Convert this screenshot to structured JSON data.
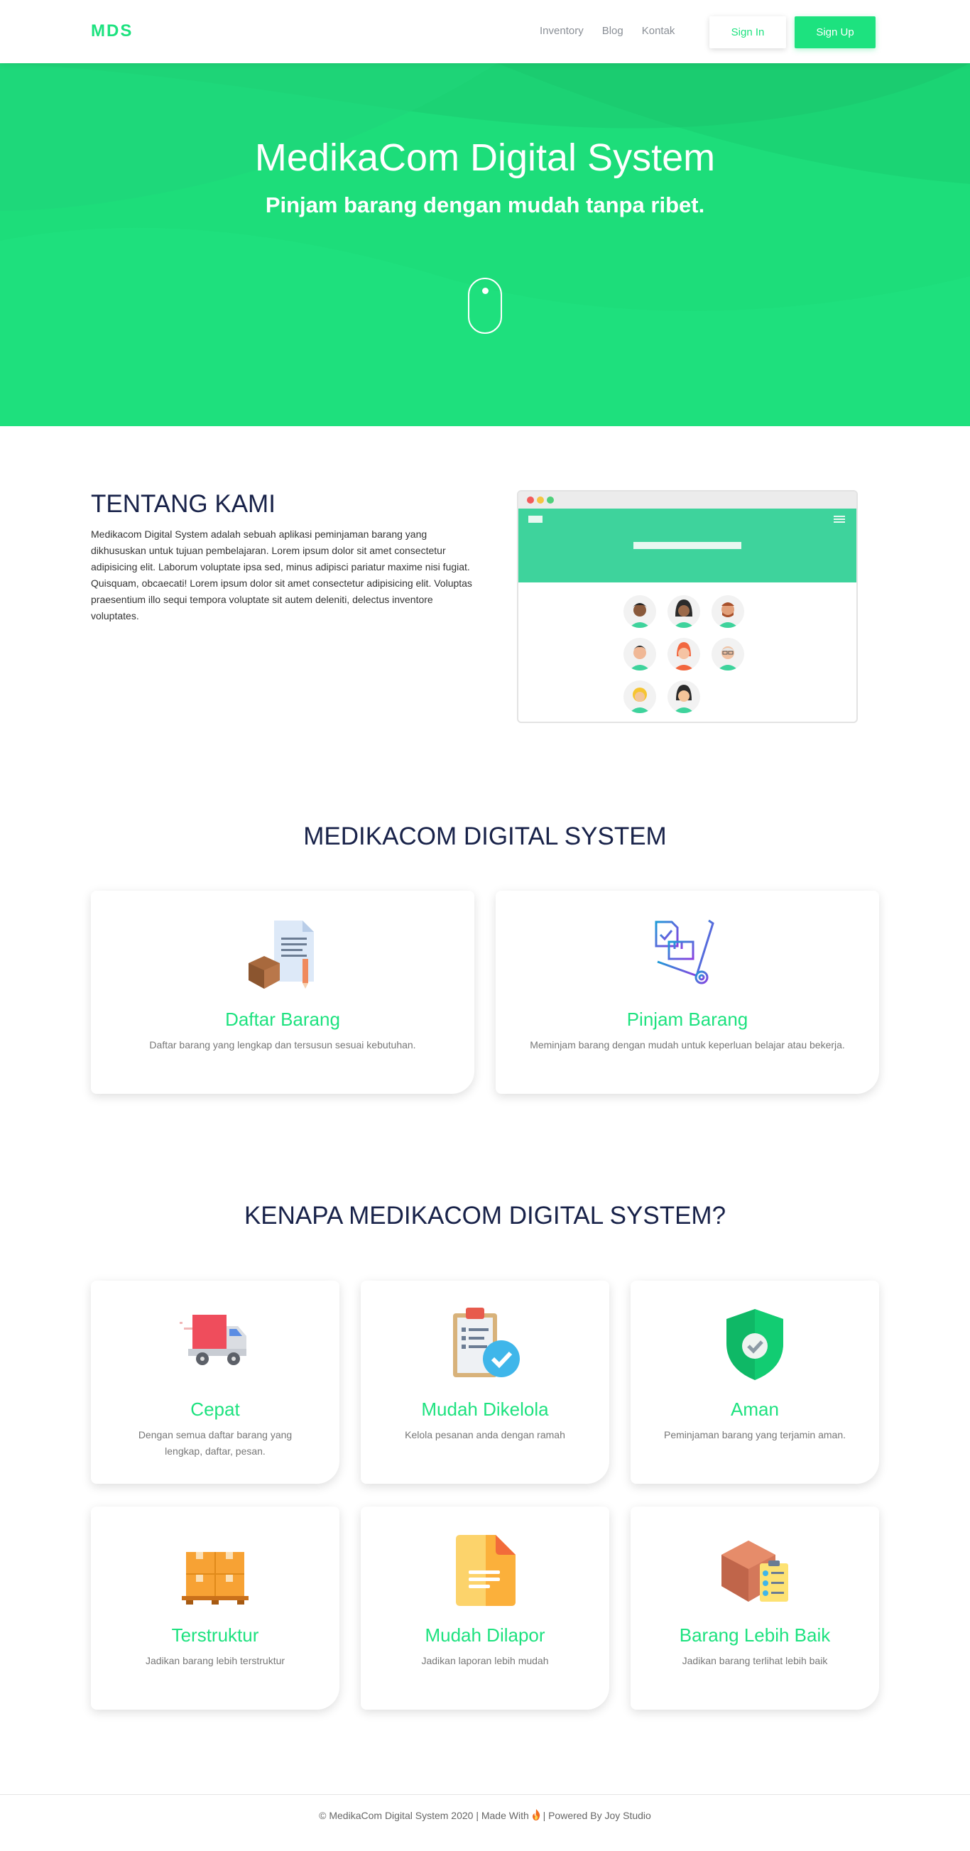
{
  "nav": {
    "brand": "MDS",
    "links": [
      "Inventory",
      "Blog",
      "Kontak"
    ],
    "signin": "Sign In",
    "signup": "Sign Up"
  },
  "hero": {
    "title": "MedikaCom Digital System",
    "subtitle": "Pinjam barang dengan mudah tanpa ribet."
  },
  "about": {
    "title": "TENTANG KAMI",
    "text": "Medikacom Digital System adalah sebuah aplikasi peminjaman barang yang dikhususkan untuk tujuan pembelajaran. Lorem ipsum dolor sit amet consectetur adipisicing elit. Laborum voluptate ipsa sed, minus adipisci pariatur maxime nisi fugiat. Quisquam, obcaecati! Lorem ipsum dolor sit amet consectetur adipisicing elit. Voluptas praesentium illo sequi tempora voluptate sit autem deleniti, delectus inventore voluptates."
  },
  "services": {
    "title": "MEDIKACOM DIGITAL SYSTEM",
    "items": [
      {
        "title": "Daftar Barang",
        "desc": "Daftar barang yang lengkap dan tersusun sesuai kebutuhan.",
        "icon": "box-document-icon"
      },
      {
        "title": "Pinjam Barang",
        "desc": "Meminjam barang dengan mudah untuk keperluan belajar atau bekerja.",
        "icon": "hand-truck-icon"
      }
    ]
  },
  "why": {
    "title": "KENAPA MEDIKACOM DIGITAL SYSTEM?",
    "items": [
      {
        "title": "Cepat",
        "desc": "Dengan semua daftar barang yang lengkap, daftar, pesan.",
        "icon": "truck-icon"
      },
      {
        "title": "Mudah Dikelola",
        "desc": "Kelola pesanan anda dengan ramah",
        "icon": "clipboard-check-icon"
      },
      {
        "title": "Aman",
        "desc": "Peminjaman barang yang terjamin aman.",
        "icon": "shield-check-icon"
      },
      {
        "title": "Terstruktur",
        "desc": "Jadikan barang lebih terstruktur",
        "icon": "pallet-boxes-icon"
      },
      {
        "title": "Mudah Dilapor",
        "desc": "Jadikan laporan lebih mudah",
        "icon": "document-icon"
      },
      {
        "title": "Barang Lebih Baik",
        "desc": "Jadikan barang terlihat lebih baik",
        "icon": "box-checklist-icon"
      }
    ]
  },
  "footer": {
    "left": "© MedikaCom Digital System 2020 | Made With",
    "right": "| Powered By Joy Studio"
  },
  "colors": {
    "accent": "#1de27f",
    "heading": "#182249",
    "hero_bg": "#1ddd7a"
  }
}
